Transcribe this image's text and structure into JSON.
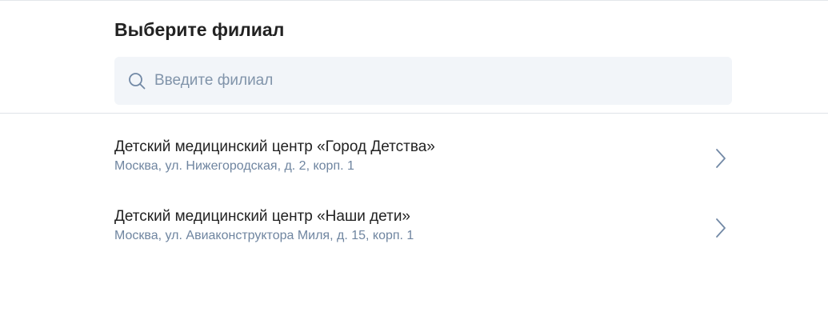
{
  "header": {
    "title": "Выберите филиал"
  },
  "search": {
    "placeholder": "Введите филиал",
    "value": "",
    "icon": "search-icon"
  },
  "branches": [
    {
      "name": "Детский медицинский центр «Город Детства»",
      "address": "Москва, ул. Нижегородская, д. 2, корп. 1",
      "icon": "chevron-right-icon"
    },
    {
      "name": "Детский медицинский центр «Наши дети»",
      "address": "Москва, ул. Авиаконструктора Миля, д. 15, корп. 1",
      "icon": "chevron-right-icon"
    }
  ],
  "colors": {
    "title": "#222222",
    "address": "#6f85a0",
    "search_bg": "#f2f5f9",
    "placeholder": "#8194aa",
    "icon": "#7289a6",
    "divider": "#dfe3e8"
  }
}
